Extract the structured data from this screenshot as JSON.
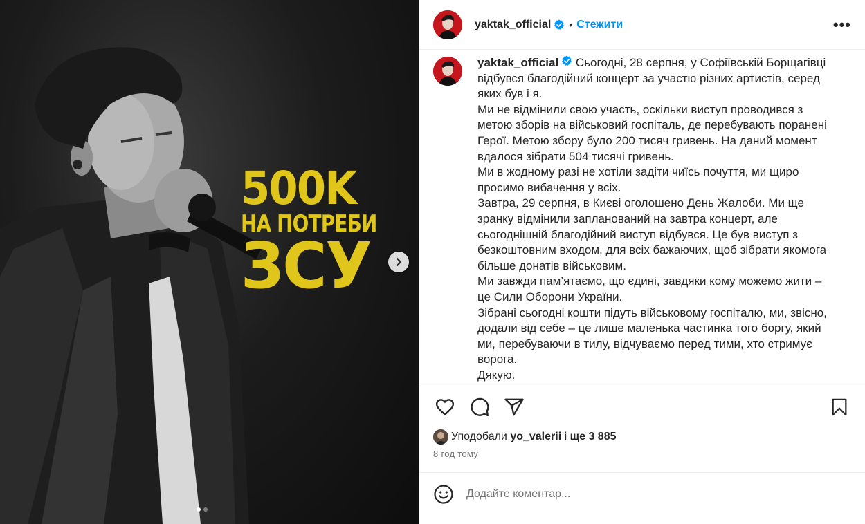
{
  "poster": {
    "line1": "500K",
    "line2": "НА ПОТРЕБИ",
    "line3": "ЗСУ"
  },
  "carousel": {
    "slides": 2,
    "active": 0
  },
  "header": {
    "username": "yaktak_official",
    "separator": "•",
    "follow_label": "Стежити",
    "more_label": "•••"
  },
  "caption": {
    "username": "yaktak_official",
    "lines": [
      "Сьогодні, 28 серпня, у Софіївській Борщагівці відбувся благодійний концерт за участю різних артистів, серед яких був і я.",
      "Ми не відмінили свою участь, оскільки виступ проводився з метою зборів на військовий госпіталь, де перебувають поранені Герої. Метою збору було 200 тисяч гривень. На даний момент вдалося зібрати 504 тисячі гривень.",
      "Ми в жодному разі не хотіли задіти чиїсь почуття, ми щиро просимо вибачення у всіх.",
      "Завтра, 29 серпня, в Києві оголошено День Жалоби. Ми ще зранку відмінили запланований на завтра концерт, але сьогоднішній благодійний виступ відбувся. Це був виступ з безкоштовним входом, для всіх бажаючих, щоб зібрати якомога більше донатів військовим.",
      "Ми завжди пам’ятаємо, що єдині, завдяки кому можемо жити – це Сили Оборони України.",
      "Зібрані сьогодні кошти підуть військовому госпіталю, ми, звісно, додали від себе – це лише маленька частинка того боргу, який ми, перебуваючи в тилу, відчуваємо перед тими, хто стримує ворога.",
      "Дякую."
    ]
  },
  "likes": {
    "prefix": "Уподобали",
    "user": "yo_valerii",
    "conj": "і",
    "more": "ще 3 885"
  },
  "time_ago": "8 год тому",
  "comment": {
    "placeholder": "Додайте коментар..."
  },
  "colors": {
    "accent": "#0095f6",
    "poster_yellow": "#e0c51a",
    "avatar_red": "#c4161c"
  }
}
